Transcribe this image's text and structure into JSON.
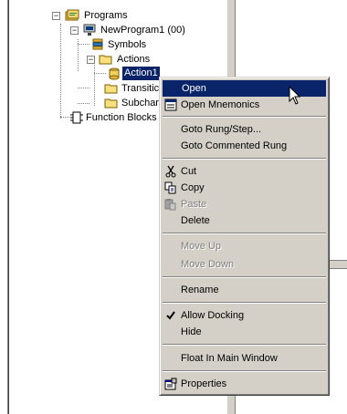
{
  "tree": {
    "programs": "Programs",
    "newprogram": "NewProgram1 (00)",
    "symbols": "Symbols",
    "actions": "Actions",
    "action1": "Action1",
    "transitions": "Transitic",
    "subcharts": "Subchar",
    "function_blocks": "Function Blocks"
  },
  "menu": {
    "open": "Open",
    "open_mnemonics": "Open Mnemonics",
    "goto_rung": "Goto Rung/Step...",
    "goto_commented": "Goto Commented Rung",
    "cut": "Cut",
    "copy": "Copy",
    "paste": "Paste",
    "delete": "Delete",
    "move_up": "Move Up",
    "move_down": "Move Down",
    "rename": "Rename",
    "allow_docking": "Allow Docking",
    "hide": "Hide",
    "float": "Float In Main Window",
    "properties": "Properties"
  },
  "icons": {
    "check": "check-icon",
    "cut": "scissors-icon",
    "copy": "copy-icon",
    "paste": "paste-icon",
    "properties": "properties-icon",
    "mnemonics": "mnemonics-icon"
  },
  "colors": {
    "highlight": "#0a246a",
    "menu_bg": "#d4d0c8",
    "disabled": "#808080"
  }
}
